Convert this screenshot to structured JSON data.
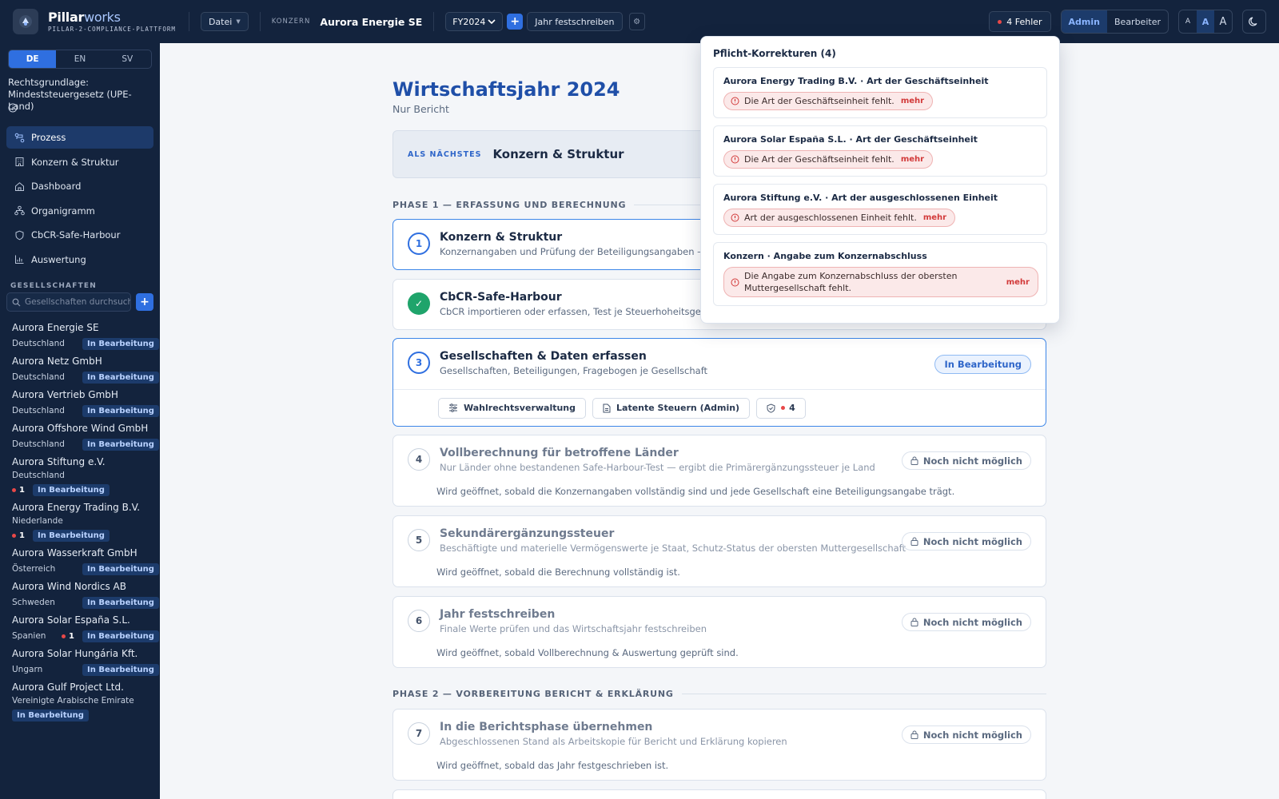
{
  "topbar": {
    "brand_name_a": "Pillar",
    "brand_name_b": "works",
    "brand_sub": "PILLAR-2-COMPLIANCE-PLATTFORM",
    "file_menu": "Datei",
    "konzern_label": "KONZERN",
    "konzern_name": "Aurora Energie SE",
    "fiscal_year": "FY2024",
    "add_year": "+",
    "lock_year_button": "Jahr festschreiben",
    "errors_button": "4 Fehler",
    "roles": [
      "Admin",
      "Bearbeiter"
    ],
    "active_role": "Admin",
    "font_sizes": [
      "A",
      "A",
      "A"
    ]
  },
  "sidebar": {
    "languages": [
      "DE",
      "EN",
      "SV"
    ],
    "active_language": "DE",
    "legal_basis": "Rechtsgrundlage: Mindeststeuergesetz (UPE-Land)",
    "nav": [
      {
        "label": "Prozess",
        "icon": "process-icon"
      },
      {
        "label": "Konzern & Struktur",
        "icon": "building-icon"
      },
      {
        "label": "Dashboard",
        "icon": "home-icon"
      },
      {
        "label": "Organigramm",
        "icon": "org-chart-icon"
      },
      {
        "label": "CbCR-Safe-Harbour",
        "icon": "shield-icon"
      },
      {
        "label": "Auswertung",
        "icon": "bar-chart-icon"
      }
    ],
    "section_label": "GESELLSCHAFTEN",
    "search_placeholder": "Gesellschaften durchsuchen",
    "add_company": "+",
    "companies": [
      {
        "name": "Aurora Energie SE",
        "country": "Deutschland",
        "status": "In Bearbeitung",
        "errors": ""
      },
      {
        "name": "Aurora Netz GmbH",
        "country": "Deutschland",
        "status": "In Bearbeitung",
        "errors": ""
      },
      {
        "name": "Aurora Vertrieb GmbH",
        "country": "Deutschland",
        "status": "In Bearbeitung",
        "errors": ""
      },
      {
        "name": "Aurora Offshore Wind GmbH",
        "country": "Deutschland",
        "status": "In Bearbeitung",
        "errors": ""
      },
      {
        "name": "Aurora Stiftung e.V.",
        "country": "Deutschland",
        "status": "In Bearbeitung",
        "errors": "1"
      },
      {
        "name": "Aurora Energy Trading B.V.",
        "country": "Niederlande",
        "status": "In Bearbeitung",
        "errors": "1"
      },
      {
        "name": "Aurora Wasserkraft GmbH",
        "country": "Österreich",
        "status": "In Bearbeitung",
        "errors": ""
      },
      {
        "name": "Aurora Wind Nordics AB",
        "country": "Schweden",
        "status": "In Bearbeitung",
        "errors": ""
      },
      {
        "name": "Aurora Solar España S.L.",
        "country": "Spanien",
        "status": "In Bearbeitung",
        "errors": "1"
      },
      {
        "name": "Aurora Solar Hungária Kft.",
        "country": "Ungarn",
        "status": "In Bearbeitung",
        "errors": ""
      },
      {
        "name": "Aurora Gulf Project Ltd.",
        "country": "Vereinigte Arabische Emirate",
        "status": "In Bearbeitung",
        "errors": ""
      }
    ]
  },
  "main": {
    "title": "Wirtschaftsjahr 2024",
    "subtitle": "Nur Bericht",
    "next_label": "ALS NÄCHSTES",
    "next_value": "Konzern & Struktur",
    "phase1": "PHASE 1 — ERFASSUNG UND BERECHNUNG",
    "phase2": "PHASE 2 — VORBEREITUNG BERICHT & ERKLÄRUNG",
    "steps": [
      {
        "num": "1",
        "title": "Konzern & Struktur",
        "desc": "Konzernangaben und Prüfung der Beteiligungsangaben — g"
      },
      {
        "num": "✓",
        "title": "CbCR-Safe-Harbour",
        "desc": "CbCR importieren oder erfassen, Test je Steuerhoheitsgebi"
      },
      {
        "num": "3",
        "title": "Gesellschaften & Daten erfassen",
        "desc": "Gesellschaften, Beteiligungen, Fragebogen je Gesellschaft",
        "status": "In Bearbeitung",
        "actions": [
          "Wahlrechtsverwaltung",
          "Latente Steuern (Admin)",
          "4"
        ]
      },
      {
        "num": "4",
        "title": "Vollberechnung für betroffene Länder",
        "desc": "Nur Länder ohne bestandenen Safe-Harbour-Test — ergibt die Primärergänzungssteuer je Land",
        "status": "Noch nicht möglich",
        "note": "Wird geöffnet, sobald die Konzernangaben vollständig sind und jede Gesellschaft eine Beteiligungsangabe trägt."
      },
      {
        "num": "5",
        "title": "Sekundärergänzungssteuer",
        "desc": "Beschäftigte und materielle Vermögenswerte je Staat, Schutz-Status der obersten Muttergesellschaft",
        "status": "Noch nicht möglich",
        "note": "Wird geöffnet, sobald die Berechnung vollständig ist."
      },
      {
        "num": "6",
        "title": "Jahr festschreiben",
        "desc": "Finale Werte prüfen und das Wirtschaftsjahr festschreiben",
        "status": "Noch nicht möglich",
        "note": "Wird geöffnet, sobald Vollberechnung & Auswertung geprüft sind."
      },
      {
        "num": "7",
        "title": "In die Berichtsphase übernehmen",
        "desc": "Abgeschlossenen Stand als Arbeitskopie für Bericht und Erklärung kopieren",
        "status": "Noch nicht möglich",
        "note": "Wird geöffnet, sobald das Jahr festgeschrieben ist."
      }
    ]
  },
  "popup": {
    "title": "Pflicht-Korrekturen (4)",
    "items": [
      {
        "heading": "Aurora Energy Trading B.V. · Art der Geschäftseinheit",
        "error": "Die Art der Geschäftseinheit fehlt.",
        "more": "mehr"
      },
      {
        "heading": "Aurora Solar España S.L. · Art der Geschäftseinheit",
        "error": "Die Art der Geschäftseinheit fehlt.",
        "more": "mehr"
      },
      {
        "heading": "Aurora Stiftung e.V. · Art der ausgeschlossenen Einheit",
        "error": "Art der ausgeschlossenen Einheit fehlt.",
        "more": "mehr"
      },
      {
        "heading": "Konzern · Angabe zum Konzernabschluss",
        "error": "Die Angabe zum Konzernabschluss der obersten Muttergesellschaft fehlt.",
        "more": "mehr"
      }
    ]
  },
  "colors": {
    "accent": "#2f6fe0",
    "sidebar_bg": "#13233d",
    "error": "#e84848",
    "success": "#1fa46b"
  }
}
